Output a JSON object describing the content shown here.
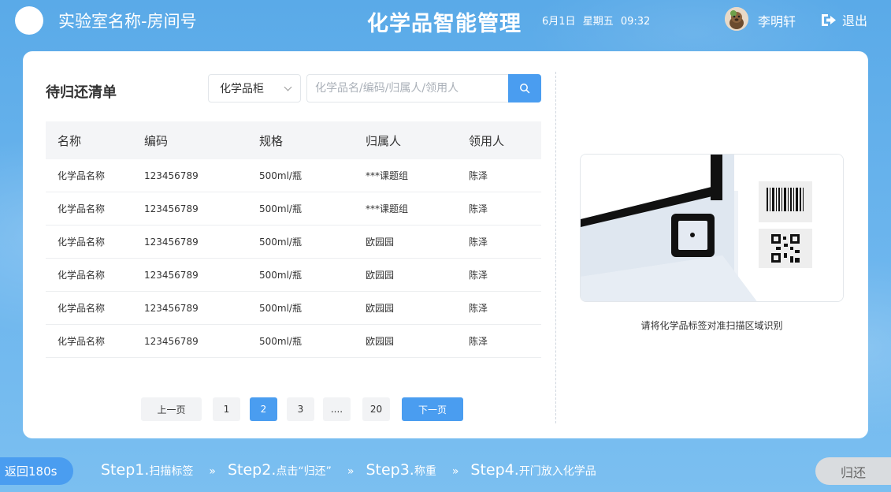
{
  "header": {
    "lab_name": "实验室名称-房间号",
    "app_title": "化学品智能管理",
    "date": "6月1日",
    "weekday": "星期五",
    "time": "09:32",
    "user_name": "李明轩",
    "logout_label": "退出"
  },
  "left": {
    "section_title": "待归还清单",
    "filter_select": "化学品柜",
    "search_placeholder": "化学品名/编码/归属人/领用人",
    "columns": [
      "名称",
      "编码",
      "规格",
      "归属人",
      "领用人"
    ],
    "rows": [
      [
        "化学品名称",
        "123456789",
        "500ml/瓶",
        "***课题组",
        "陈泽"
      ],
      [
        "化学品名称",
        "123456789",
        "500ml/瓶",
        "***课题组",
        "陈泽"
      ],
      [
        "化学品名称",
        "123456789",
        "500ml/瓶",
        "欧园园",
        "陈泽"
      ],
      [
        "化学品名称",
        "123456789",
        "500ml/瓶",
        "欧园园",
        "陈泽"
      ],
      [
        "化学品名称",
        "123456789",
        "500ml/瓶",
        "欧园园",
        "陈泽"
      ],
      [
        "化学品名称",
        "123456789",
        "500ml/瓶",
        "欧园园",
        "陈泽"
      ]
    ],
    "pagination": {
      "prev": "上一页",
      "pages": [
        "1",
        "2",
        "3",
        "....",
        "20"
      ],
      "current": "2",
      "next": "下一页"
    }
  },
  "right": {
    "scan_hint": "请将化学品标签对准扫描区域识别"
  },
  "footer": {
    "back_label": "返回180s",
    "steps": [
      {
        "label": "Step1.",
        "text": "扫描标签"
      },
      {
        "label": "Step2.",
        "text": "点击“归还”"
      },
      {
        "label": "Step3.",
        "text": "称重"
      },
      {
        "label": "Step4.",
        "text": "开门放入化学品"
      }
    ],
    "step_separator": "»",
    "return_label": "归还"
  },
  "colors": {
    "accent": "#4a9df0",
    "background": "#6db6ee",
    "card": "#ffffff"
  }
}
